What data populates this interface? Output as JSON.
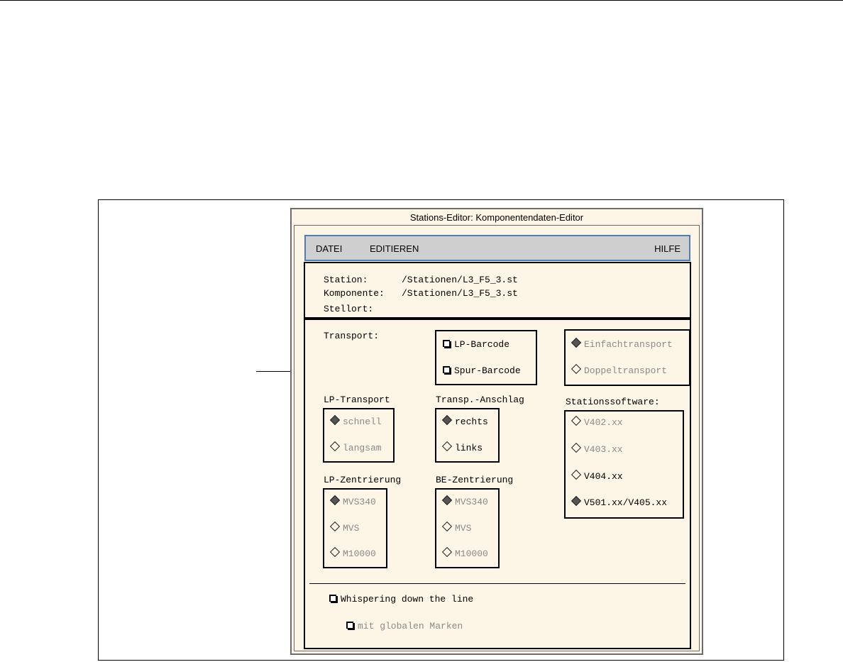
{
  "window": {
    "title": "Stations-Editor: Komponentendaten-Editor"
  },
  "menu": {
    "datei": "DATEI",
    "editieren": "EDITIEREN",
    "hilfe": "HILFE"
  },
  "info": {
    "station_label": "Station:",
    "station_value": "/Stationen/L3_F5_3.st",
    "komponente_label": "Komponente:",
    "komponente_value": "/Stationen/L3_F5_3.st",
    "stellort_label": "Stellort:"
  },
  "transport": {
    "label": "Transport:",
    "barcode": {
      "lp": "LP-Barcode",
      "spur": "Spur-Barcode"
    },
    "mode": {
      "einfach": "Einfachtransport",
      "doppel": "Doppeltransport"
    }
  },
  "lp_transport": {
    "label": "LP-Transport",
    "schnell": "schnell",
    "langsam": "langsam"
  },
  "anschlag": {
    "label": "Transp.-Anschlag",
    "rechts": "rechts",
    "links": "links"
  },
  "software": {
    "label": "Stationssoftware:",
    "options": [
      "V402.xx",
      "V403.xx",
      "V404.xx",
      "V501.xx/V405.xx"
    ]
  },
  "lp_zentrierung": {
    "label": "LP-Zentrierung",
    "options": [
      "MVS340",
      "MVS",
      "M10000"
    ]
  },
  "be_zentrierung": {
    "label": "BE-Zentrierung",
    "options": [
      "MVS340",
      "MVS",
      "M10000"
    ]
  },
  "whispering": {
    "label": "Whispering down the line",
    "global": "mit globalen Marken"
  }
}
